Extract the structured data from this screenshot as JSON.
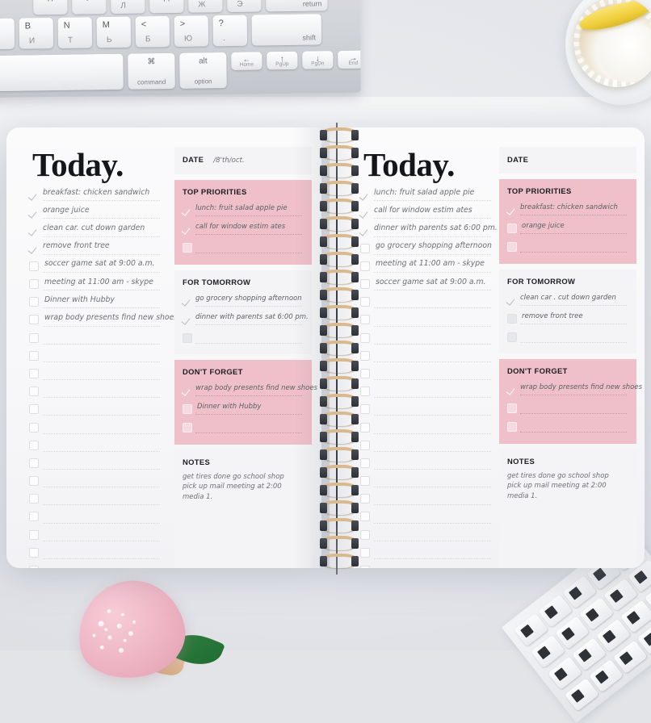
{
  "scene": {
    "background_color": "#e6e8ec",
    "objects": [
      {
        "name": "apple-magic-keyboard",
        "note": "bilingual English/Russian keycaps, top-left"
      },
      {
        "name": "lemon-tart",
        "note": "lemon tart with whipped cream in white paper liner, top-right"
      },
      {
        "name": "pink-tulip-ornament",
        "note": "pink pearl-studded tulip with green leaf, bottom-left"
      },
      {
        "name": "desk-object-bottom-right",
        "note": "angled keyboard edge, bottom-right"
      }
    ]
  },
  "keyboard": {
    "rows": [
      [
        {
          "latin": "",
          "cyrillic": "П"
        },
        {
          "latin": "",
          "cyrillic": "Р"
        },
        {
          "latin": "O",
          "cyrillic": "Л"
        },
        {
          "latin": "",
          "cyrillic": "Д"
        },
        {
          "latin": ";",
          "cyrillic": "Ж"
        },
        {
          "latin": "'",
          "cyrillic": "Э"
        },
        {
          "modifier": "return"
        }
      ],
      [
        {
          "latin": "V",
          "cyrillic": "М"
        },
        {
          "latin": "B",
          "cyrillic": "И"
        },
        {
          "latin": "N",
          "cyrillic": "Т"
        },
        {
          "latin": "M",
          "cyrillic": "Ь"
        },
        {
          "latin": "<",
          "cyrillic": "Б"
        },
        {
          "latin": ">",
          "cyrillic": "Ю"
        },
        {
          "latin": "?",
          "cyrillic": "."
        },
        {
          "modifier": "shift"
        }
      ],
      [
        {
          "modifier": "space"
        },
        {
          "glyph": "⌘",
          "modifier": "command"
        },
        {
          "glyph": "alt",
          "modifier": "option"
        },
        {
          "glyph": "←",
          "modifier": "Home"
        },
        {
          "glyph": "↑",
          "modifier": "PgUp"
        },
        {
          "glyph": "↓",
          "modifier": "PgDn"
        },
        {
          "glyph": "→",
          "modifier": "End"
        }
      ]
    ]
  },
  "notebook": {
    "accent_pink": "#f0c0ca",
    "panel_gray": "#f4f4f6",
    "page_white": "#fbfbfc",
    "spiral_color": "#d9b98f",
    "left_page": {
      "title": "Today.",
      "tasks": [
        {
          "text": "breakfast: chicken sandwich",
          "checked": true
        },
        {
          "text": "orange juice",
          "checked": true
        },
        {
          "text": "clean car. cut down garden",
          "checked": true
        },
        {
          "text": "remove front tree",
          "checked": true
        },
        {
          "text": "soccer game sat at 9:00 a.m.",
          "checked": false
        },
        {
          "text": "meeting at 11:00 am - skype",
          "checked": false
        },
        {
          "text": "Dinner with Hubby",
          "checked": false
        },
        {
          "text": "wrap body presents find new shoes",
          "checked": false
        }
      ],
      "empty_task_rows": 14,
      "date": {
        "label": "DATE",
        "value": "/8'th/oct."
      },
      "top_priorities": {
        "label": "TOP PRIORITIES",
        "items": [
          {
            "text": "lunch: fruit salad apple pie",
            "checked": true
          },
          {
            "text": "call for window estim ates",
            "checked": true
          },
          {
            "text": "",
            "checked": false
          }
        ]
      },
      "for_tomorrow": {
        "label": "FOR TOMORROW",
        "items": [
          {
            "text": "go grocery shopping afternoon",
            "checked": true
          },
          {
            "text": "dinner with parents sat 6:00 pm.",
            "checked": true
          },
          {
            "text": "",
            "checked": false
          }
        ]
      },
      "dont_forget": {
        "label": "DON'T FORGET",
        "items": [
          {
            "text": "wrap body presents find new shoes",
            "checked": true
          },
          {
            "text": "Dinner with Hubby",
            "checked": false
          },
          {
            "text": "",
            "checked": false
          }
        ]
      },
      "notes": {
        "label": "NOTES",
        "lines": [
          "get tires done go school shop",
          "pick up mail meeting at 2:00 media 1."
        ]
      }
    },
    "right_page": {
      "title": "Today.",
      "tasks": [
        {
          "text": "lunch: fruit salad apple pie",
          "checked": true
        },
        {
          "text": "call for window estim ates",
          "checked": true
        },
        {
          "text": "dinner with parents sat 6:00 pm.",
          "checked": true
        },
        {
          "text": "go grocery shopping afternoon",
          "checked": false
        },
        {
          "text": "meeting at 11:00 am - skype",
          "checked": false
        },
        {
          "text": "soccer game sat at 9:00 a.m.",
          "checked": false
        }
      ],
      "empty_task_rows": 16,
      "date": {
        "label": "DATE",
        "value": ""
      },
      "top_priorities": {
        "label": "TOP PRIORITIES",
        "items": [
          {
            "text": "breakfast: chicken sandwich",
            "checked": true
          },
          {
            "text": "orange juice",
            "checked": false
          },
          {
            "text": "",
            "checked": false
          }
        ]
      },
      "for_tomorrow": {
        "label": "FOR TOMORROW",
        "items": [
          {
            "text": "clean car . cut down garden",
            "checked": true
          },
          {
            "text": "remove front tree",
            "checked": false
          },
          {
            "text": "",
            "checked": false
          }
        ]
      },
      "dont_forget": {
        "label": "DON'T FORGET",
        "items": [
          {
            "text": "wrap body presents find new shoes",
            "checked": true
          },
          {
            "text": "",
            "checked": false
          },
          {
            "text": "",
            "checked": false
          }
        ]
      },
      "notes": {
        "label": "NOTES",
        "lines": [
          "get tires done go school shop",
          "pick up mail meeting at 2:00 media 1."
        ]
      }
    }
  }
}
